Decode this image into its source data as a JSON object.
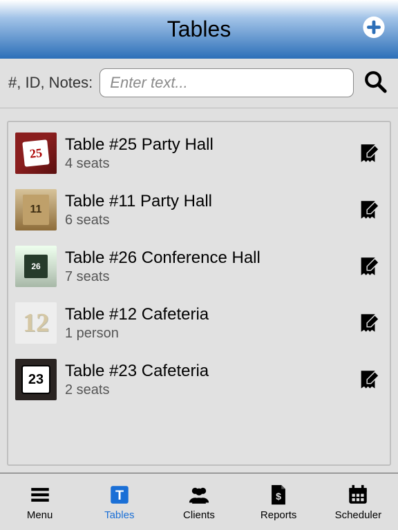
{
  "header": {
    "title": "Tables"
  },
  "search": {
    "label": "#, ID, Notes:",
    "placeholder": "Enter text..."
  },
  "tables": [
    {
      "title": "Table #25 Party Hall",
      "sub": "4 seats",
      "num": "25",
      "thumb": "th-25"
    },
    {
      "title": "Table #11 Party Hall",
      "sub": "6 seats",
      "num": "11",
      "thumb": "th-11"
    },
    {
      "title": "Table #26 Conference Hall",
      "sub": "7 seats",
      "num": "26",
      "thumb": "th-26"
    },
    {
      "title": "Table #12 Cafeteria",
      "sub": "1 person",
      "num": "12",
      "thumb": "th-12"
    },
    {
      "title": "Table #23 Cafeteria",
      "sub": "2 seats",
      "num": "23",
      "thumb": "th-23"
    }
  ],
  "tabs": {
    "menu": "Menu",
    "tables": "Tables",
    "clients": "Clients",
    "reports": "Reports",
    "scheduler": "Scheduler",
    "active": "tables"
  }
}
